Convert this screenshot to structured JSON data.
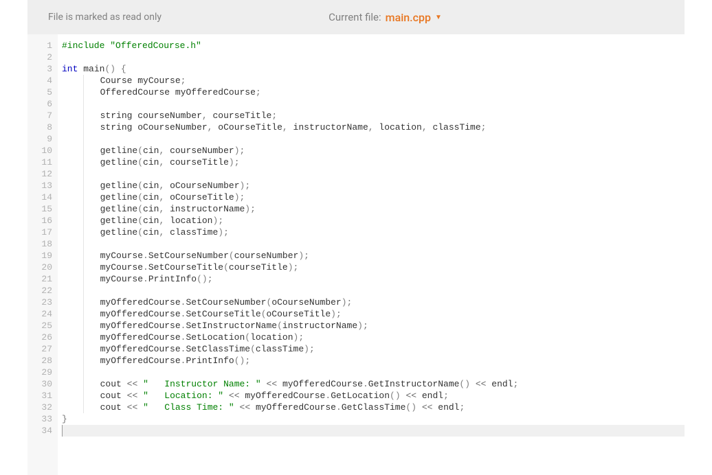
{
  "header": {
    "readonly_label": "File is marked as read only",
    "current_file_label": "Current file:",
    "file_name": "main.cpp"
  },
  "editor": {
    "line_count": 34,
    "current_line": 34
  },
  "code": {
    "l1": {
      "pp": "#include",
      "str": "\"OfferedCourse.h\""
    },
    "l3": {
      "kw1": "int",
      "id1": "main",
      "op": "()",
      "brace": "{"
    },
    "l4": {
      "id1": "Course",
      "id2": "myCourse",
      "semi": ";"
    },
    "l5": {
      "id1": "OfferedCourse",
      "id2": "myOfferedCourse",
      "semi": ";"
    },
    "l7": {
      "id1": "string",
      "id2": "courseNumber",
      "c": ",",
      "id3": "courseTitle",
      "semi": ";"
    },
    "l8": {
      "id1": "string",
      "id2": "oCourseNumber",
      "c1": ",",
      "id3": "oCourseTitle",
      "c2": ",",
      "id4": "instructorName",
      "c3": ",",
      "id5": "location",
      "c4": ",",
      "id6": "classTime",
      "semi": ";"
    },
    "l10": {
      "fn": "getline",
      "a1": "cin",
      "c": ",",
      "a2": "courseNumber"
    },
    "l11": {
      "fn": "getline",
      "a1": "cin",
      "c": ",",
      "a2": "courseTitle"
    },
    "l13": {
      "fn": "getline",
      "a1": "cin",
      "c": ",",
      "a2": "oCourseNumber"
    },
    "l14": {
      "fn": "getline",
      "a1": "cin",
      "c": ",",
      "a2": "oCourseTitle"
    },
    "l15": {
      "fn": "getline",
      "a1": "cin",
      "c": ",",
      "a2": "instructorName"
    },
    "l16": {
      "fn": "getline",
      "a1": "cin",
      "c": ",",
      "a2": "location"
    },
    "l17": {
      "fn": "getline",
      "a1": "cin",
      "c": ",",
      "a2": "classTime"
    },
    "l19": {
      "obj": "myCourse",
      "dot": ".",
      "fn": "SetCourseNumber",
      "arg": "courseNumber"
    },
    "l20": {
      "obj": "myCourse",
      "dot": ".",
      "fn": "SetCourseTitle",
      "arg": "courseTitle"
    },
    "l21": {
      "obj": "myCourse",
      "dot": ".",
      "fn": "PrintInfo"
    },
    "l23": {
      "obj": "myOfferedCourse",
      "dot": ".",
      "fn": "SetCourseNumber",
      "arg": "oCourseNumber"
    },
    "l24": {
      "obj": "myOfferedCourse",
      "dot": ".",
      "fn": "SetCourseTitle",
      "arg": "oCourseTitle"
    },
    "l25": {
      "obj": "myOfferedCourse",
      "dot": ".",
      "fn": "SetInstructorName",
      "arg": "instructorName"
    },
    "l26": {
      "obj": "myOfferedCourse",
      "dot": ".",
      "fn": "SetLocation",
      "arg": "location"
    },
    "l27": {
      "obj": "myOfferedCourse",
      "dot": ".",
      "fn": "SetClassTime",
      "arg": "classTime"
    },
    "l28": {
      "obj": "myOfferedCourse",
      "dot": ".",
      "fn": "PrintInfo"
    },
    "l30": {
      "id": "cout",
      "op1": "<<",
      "str": "\"   Instructor Name: \"",
      "op2": "<<",
      "obj": "myOfferedCourse",
      "dot": ".",
      "fn": "GetInstructorName",
      "op3": "<<",
      "end": "endl",
      "semi": ";"
    },
    "l31": {
      "id": "cout",
      "op1": "<<",
      "str": "\"   Location: \"",
      "op2": "<<",
      "obj": "myOfferedCourse",
      "dot": ".",
      "fn": "GetLocation",
      "op3": "<<",
      "end": "endl",
      "semi": ";"
    },
    "l32": {
      "id": "cout",
      "op1": "<<",
      "str": "\"   Class Time: \"",
      "op2": "<<",
      "obj": "myOfferedCourse",
      "dot": ".",
      "fn": "GetClassTime",
      "op3": "<<",
      "end": "endl",
      "semi": ";"
    },
    "l33": {
      "brace": "}"
    }
  }
}
